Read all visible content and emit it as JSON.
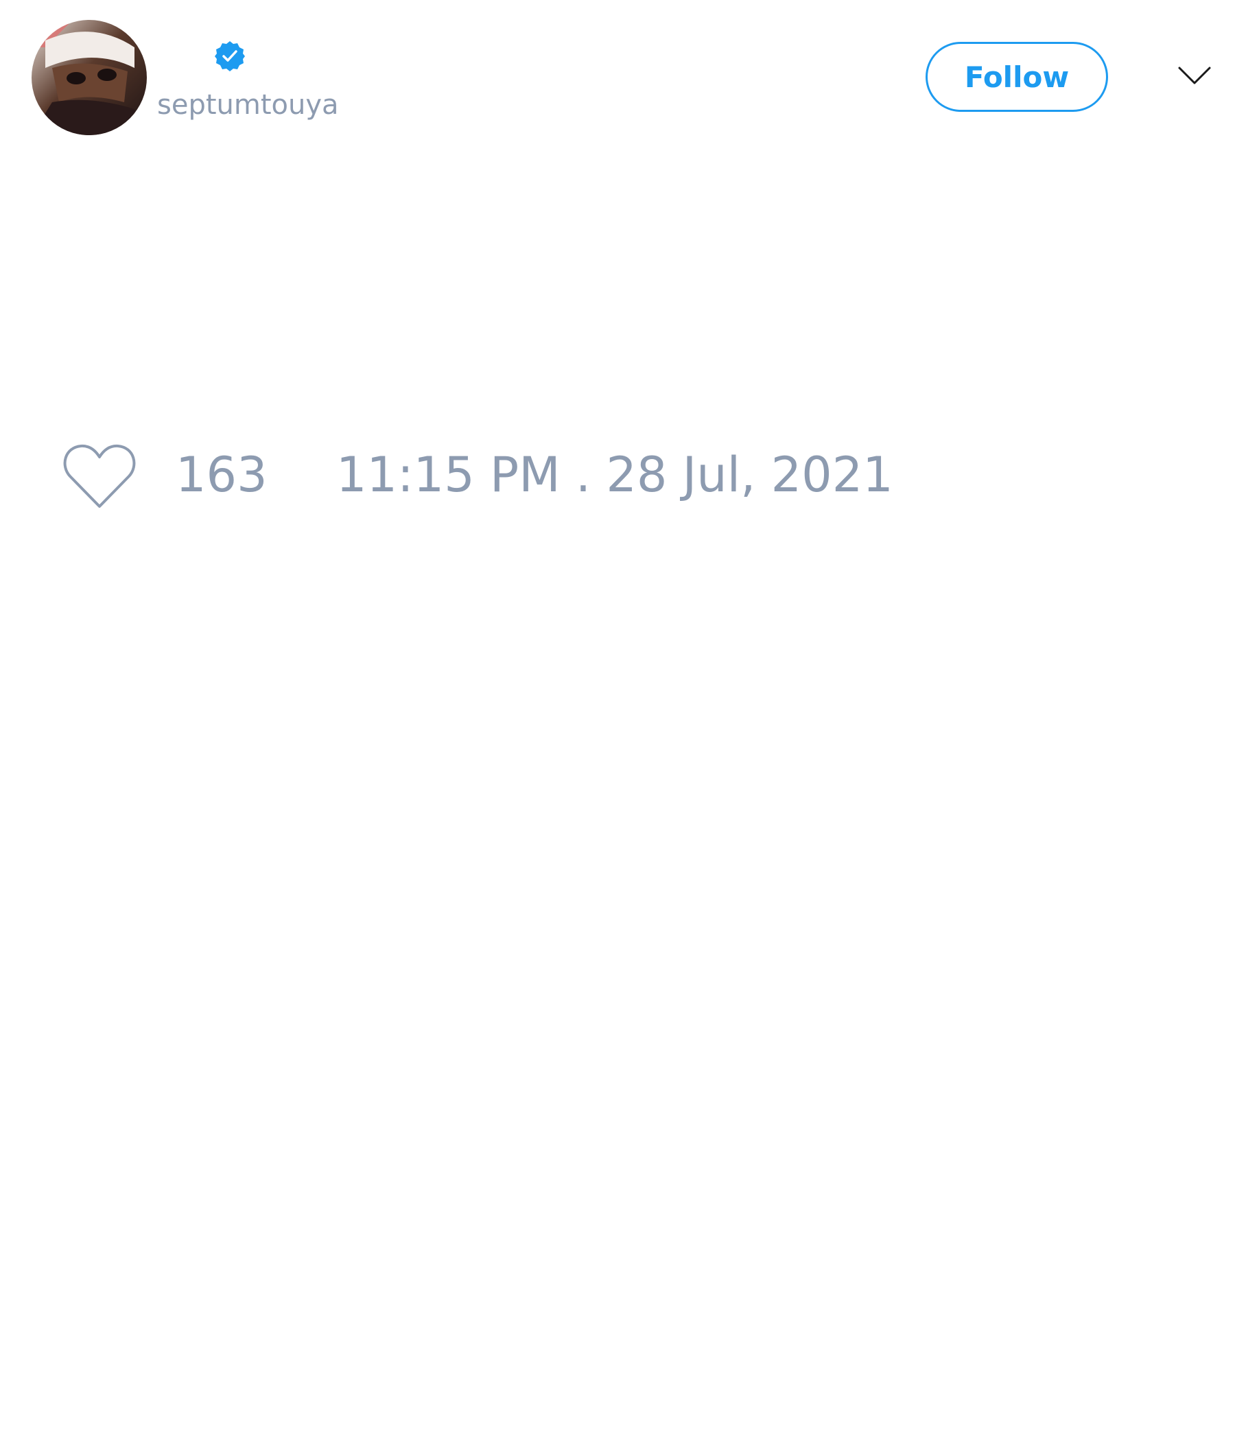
{
  "author": {
    "display_name": "",
    "handle": "septumtouya",
    "verified": true,
    "avatar_icon": "profile-avatar"
  },
  "actions": {
    "follow_label": "Follow",
    "menu_icon": "chevron-down-icon"
  },
  "engagement": {
    "like_icon": "heart-outline-icon",
    "like_count": "163"
  },
  "timestamp": "11:15 PM . 28 Jul, 2021",
  "colors": {
    "accent": "#1d9bf0",
    "muted_text": "#8d9bb0",
    "background": "#ffffff"
  }
}
